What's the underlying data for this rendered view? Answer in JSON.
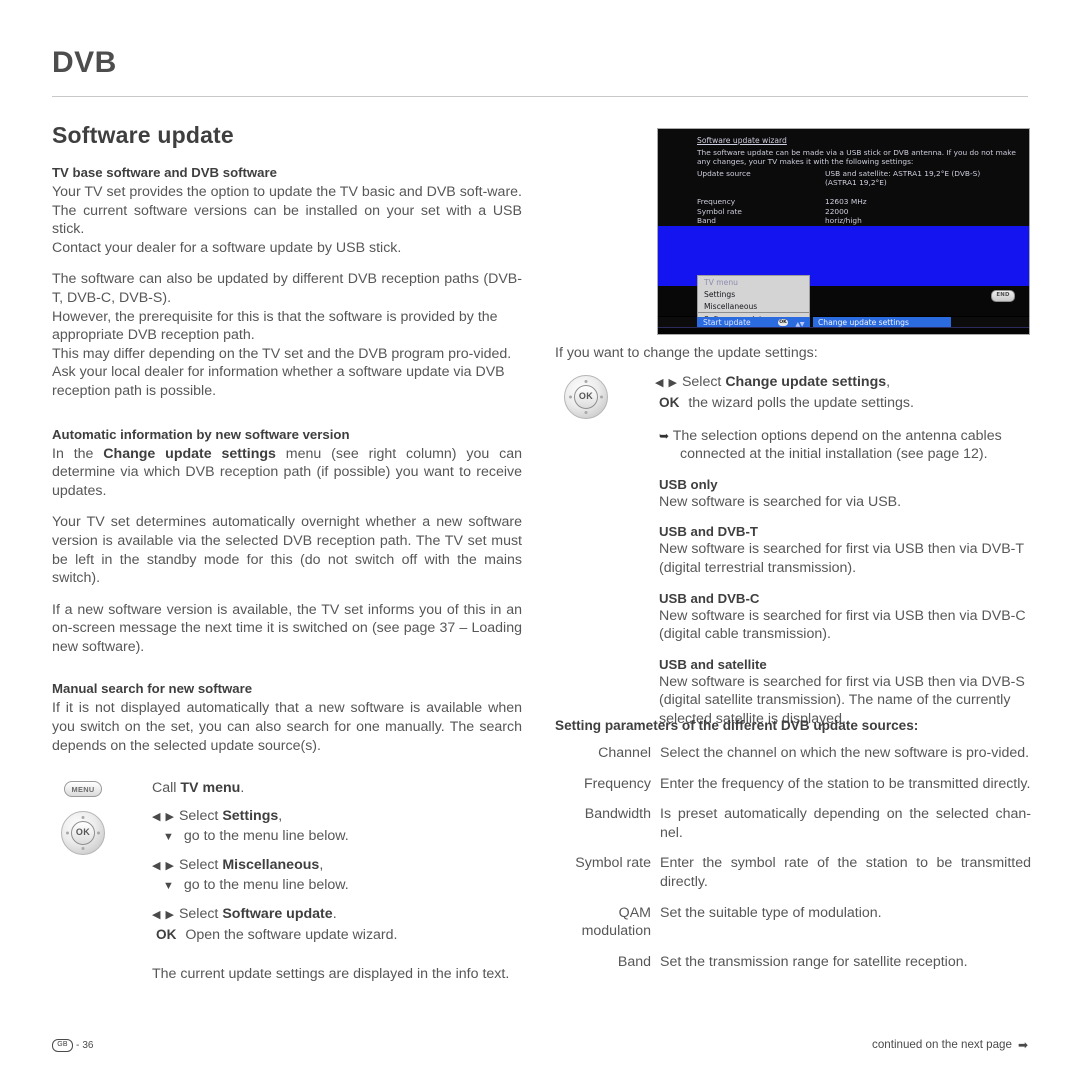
{
  "header": {
    "chapter": "DVB"
  },
  "left": {
    "section_title": "Software update",
    "sub1": {
      "heading": "TV base software and DVB software",
      "p1": "Your TV set provides the option to update the TV basic and DVB soft-ware. The current software versions can be installed on your set with a USB stick.",
      "p2": "Contact your dealer for a software update by USB stick.",
      "p3": "The software can also be updated by different DVB reception paths (DVB-T, DVB-C, DVB-S).",
      "p4": "However, the prerequisite for this is that the software is provided by the appropriate DVB reception path.",
      "p5": "This may differ depending on the TV set and the DVB program pro-vided.",
      "p6": "Ask your local dealer for information whether a software update via DVB reception path is possible."
    },
    "sub2": {
      "heading": "Automatic information by new software version",
      "p1_a": "In the ",
      "p1_b": "Change update settings",
      "p1_c": " menu (see right column) you can determine via which DVB reception path (if possible) you want to receive updates.",
      "p2": "Your TV set determines automatically overnight whether a new software version is available via the selected DVB reception path. The TV set must be left in the standby mode for this (do not switch off with the mains switch).",
      "p3": "If a new software version is available, the TV set informs you of this in an on-screen message the next time it is switched on (see page 37 – Loading new software)."
    },
    "sub3": {
      "heading": "Manual search for new software",
      "p1": "If it is not displayed automatically that a new software is available when you switch on the set, you can also search for one manually. The search depends on the selected update source(s)."
    },
    "steps": {
      "menu_key_label": "MENU",
      "menu_line_a": "Call ",
      "menu_line_b": "TV menu",
      "menu_line_c": ".",
      "ok_key_label": "OK",
      "lr_arrows": "◀ ▶",
      "down_arrow": "▼",
      "select_word": "Select ",
      "item1": "Settings",
      "item1_tail": ",",
      "goto_line": "go to the menu line below.",
      "item2": "Miscellaneous",
      "item2_tail": ",",
      "item3": "Software update",
      "item3_tail": ".",
      "ok_word": "OK",
      "ok_action": "Open the software update wizard.",
      "closing": "The current update settings are displayed in the info text."
    }
  },
  "tv_screen": {
    "wizard_title": "Software update wizard",
    "description": "The software update can be made via a USB stick or DVB antenna. If you do not make any changes, your TV makes it with the following settings:",
    "params": [
      {
        "name": "Update source",
        "value": "USB and satellite: ASTRA1 19,2°E (DVB-S)"
      },
      {
        "name": "",
        "value": "(ASTRA1 19,2°E)"
      },
      {
        "name": "Frequency",
        "value": "12603 MHz"
      },
      {
        "name": "Symbol rate",
        "value": "22000"
      },
      {
        "name": "Band",
        "value": "horiz/high"
      }
    ],
    "menu": {
      "title": "TV menu",
      "items": [
        "Settings",
        "Miscellaneous",
        "Software update"
      ]
    },
    "start_update": "Start update",
    "start_ok_badge": "OK",
    "change_update": "Change update settings",
    "end_button": "END"
  },
  "right": {
    "intro": "If you want to change the update settings:",
    "lr_arrows": "◀ ▶",
    "select_word": "Select ",
    "change_item": "Change update settings",
    "change_item_tail": ",",
    "ok_word": "OK",
    "ok_action": "the wizard polls the update settings.",
    "note": "The selection options depend on the antenna cables connected at the initial installation (see page 12).",
    "options": [
      {
        "heading": "USB only",
        "text": "New software is searched for via USB."
      },
      {
        "heading": "USB and DVB-T",
        "text": "New software is searched for first via USB then via DVB-T (digital terrestrial transmission)."
      },
      {
        "heading": "USB and DVB-C",
        "text": "New software is searched for first via USB then via DVB-C (digital cable transmission)."
      },
      {
        "heading": "USB and satellite",
        "text": "New software is searched for first via USB then via DVB-S (digital satellite transmission). The name of the currently selected satellite is displayed."
      }
    ],
    "params_title": "Setting parameters of the different DVB update sources:",
    "params_rows": [
      {
        "name": "Channel",
        "desc": "Select the channel on which the new software is pro-vided."
      },
      {
        "name": "Frequency",
        "desc": "Enter the frequency of the station to be transmitted directly."
      },
      {
        "name": "Bandwidth",
        "desc": "Is preset automatically depending on the selected chan-nel."
      },
      {
        "name": "Symbol rate",
        "desc": "Enter the symbol rate of the station to be transmitted directly."
      },
      {
        "name": "QAM modulation",
        "desc": "Set the suitable type of modulation."
      },
      {
        "name": "Band",
        "desc": "Set the transmission range for satellite reception."
      }
    ]
  },
  "footer": {
    "locale_badge": "GB",
    "page_sep": "-",
    "page_number": "36",
    "continued": "continued on the next page"
  }
}
